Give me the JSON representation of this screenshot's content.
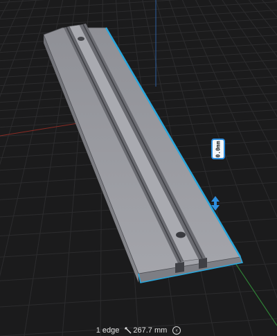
{
  "viewport": {
    "background": "#1b1b1c",
    "grid_color": "#2c2c2e",
    "x_axis_color": "#8a2b24",
    "y_axis_color": "#2d5fa0",
    "z_axis_color": "#2f7f36",
    "selection_color": "#29a7dd"
  },
  "dimension_label": {
    "value": "0.0mm"
  },
  "status_bar": {
    "selection_text": "1 edge",
    "measure_icon": "ruler-icon",
    "length_text": "267.7 mm",
    "undo_icon": "chevron-left-circle-icon"
  }
}
